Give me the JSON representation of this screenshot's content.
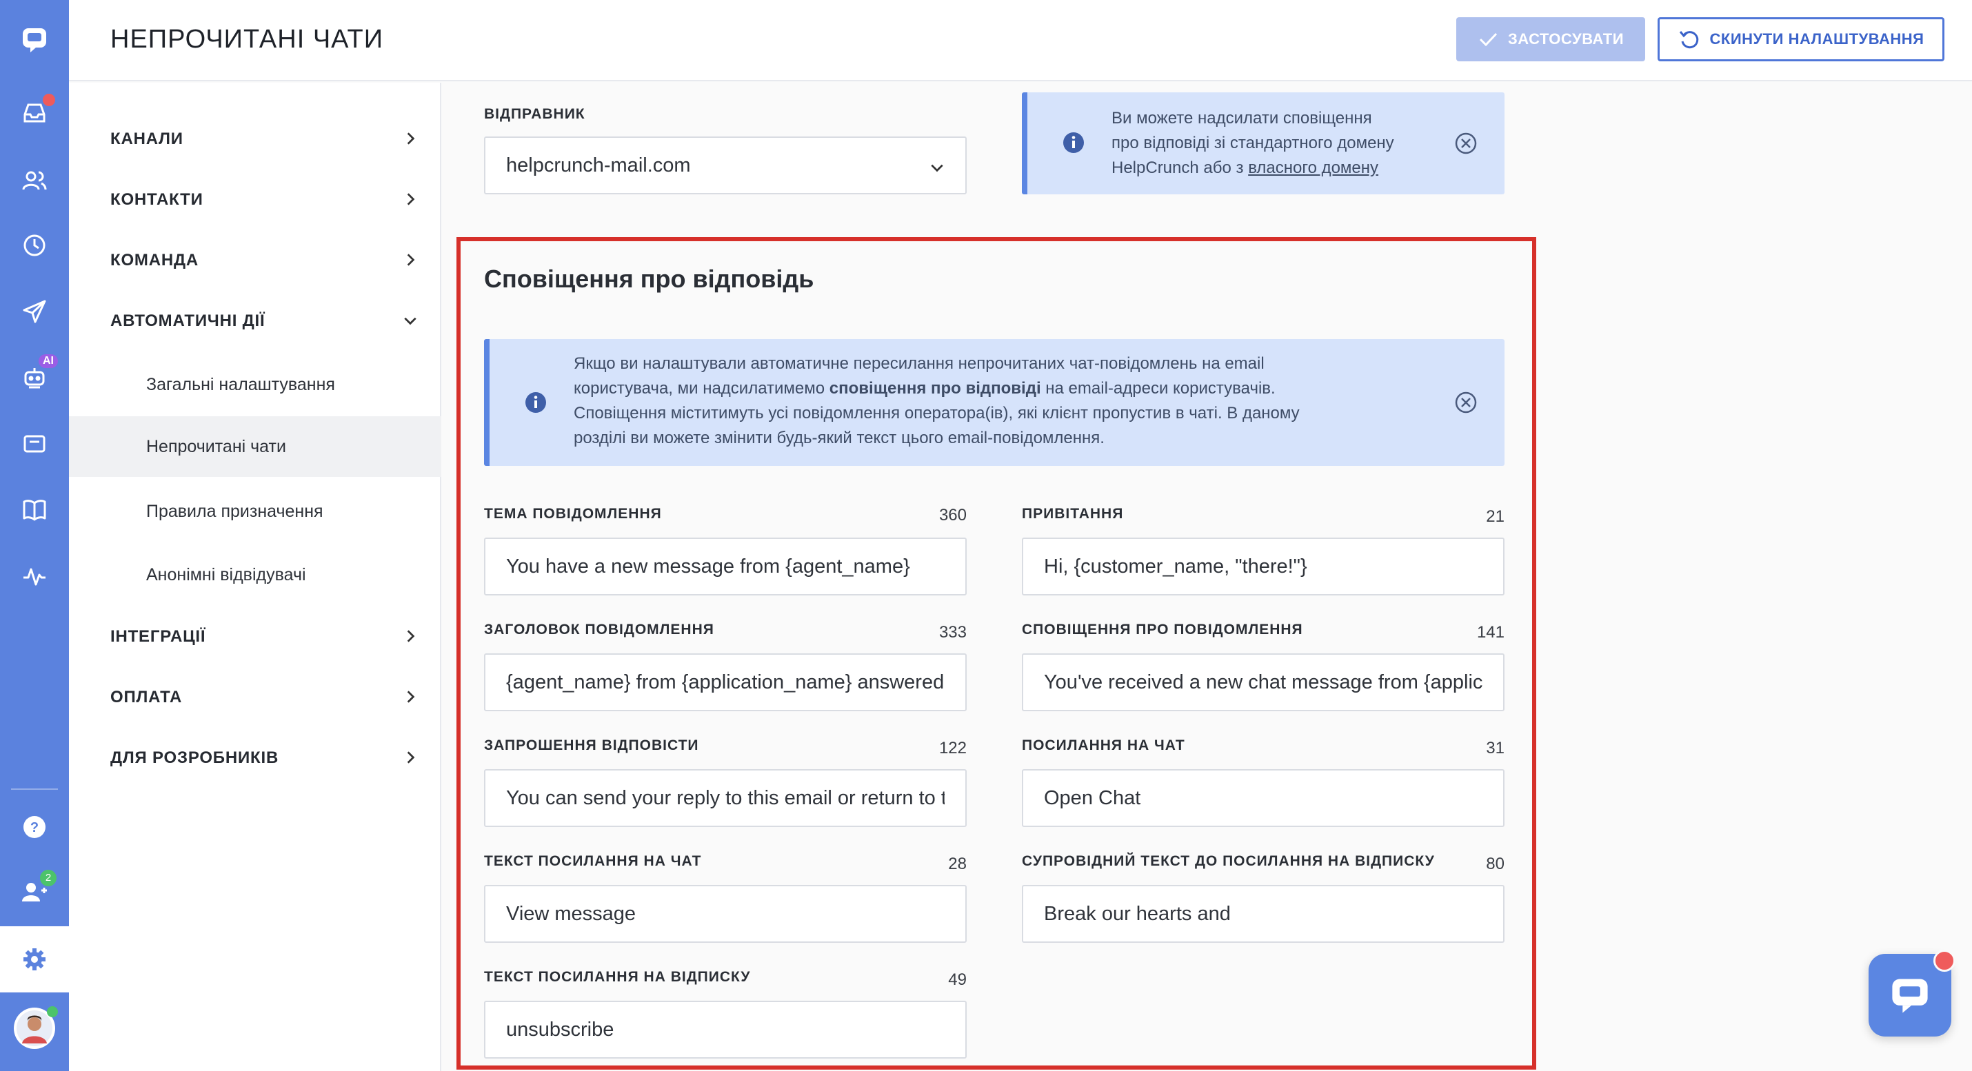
{
  "header": {
    "title": "НЕПРОЧИТАНІ ЧАТИ",
    "apply_label": "ЗАСТОСУВАТИ",
    "reset_label": "СКИНУТИ НАЛАШТУВАННЯ"
  },
  "rail": {
    "icons": [
      "logo-chat-icon",
      "inbox-icon",
      "contacts-icon",
      "clock-icon",
      "send-icon",
      "bot-icon",
      "card-icon",
      "book-icon",
      "activity-icon",
      "help-icon",
      "team-icon",
      "settings-icon",
      "avatar"
    ],
    "ai_badge": "AI",
    "team_count": "2"
  },
  "sidebar": {
    "items": [
      {
        "label": "КАНАЛИ"
      },
      {
        "label": "КОНТАКТИ"
      },
      {
        "label": "КОМАНДА"
      },
      {
        "label": "АВТОМАТИЧНІ ДІЇ"
      },
      {
        "label": "Загальні налаштування"
      },
      {
        "label": "Непрочитані чати"
      },
      {
        "label": "Правила призначення"
      },
      {
        "label": "Анонімні відвідувачі"
      },
      {
        "label": "ІНТЕГРАЦІЇ"
      },
      {
        "label": "ОПЛАТА"
      },
      {
        "label": "ДЛЯ РОЗРОБНИКІВ"
      }
    ]
  },
  "sender": {
    "label": "ВІДПРАВНИК",
    "value": "helpcrunch-mail.com"
  },
  "domain_info": {
    "line1": "Ви можете надсилати сповіщення",
    "line2": "про відповіді зі стандартного домену",
    "line3_prefix": "HelpCrunch або з ",
    "link": "власного домену"
  },
  "section": {
    "title": "Сповіщення про відповідь",
    "info_l1": "Якщо ви налаштували автоматичне пересилання непрочитаних чат-повідомлень на email",
    "info_l2_a": "користувача, ми надсилатимемо ",
    "info_l2_bold": "сповіщення про відповіді",
    "info_l2_b": " на email-адреси користувачів.",
    "info_l3": "Сповіщення міститимуть усі повідомлення оператора(ів), які клієнт пропустив в чаті. В даному",
    "info_l4": "розділі ви можете змінити будь-який текст цього email-повідомлення."
  },
  "fields": {
    "subject": {
      "label": "ТЕМА ПОВІДОМЛЕННЯ",
      "count": "360",
      "value": "You have a new message from {agent_name}"
    },
    "greeting": {
      "label": "ПРИВІТАННЯ",
      "count": "21",
      "value": "Hi, {customer_name, \"there!\"}"
    },
    "heading": {
      "label": "ЗАГОЛОВОК ПОВІДОМЛЕННЯ",
      "count": "333",
      "value": "{agent_name} from {application_name} answered"
    },
    "notification": {
      "label": "СПОВІЩЕННЯ ПРО ПОВІДОМЛЕННЯ",
      "count": "141",
      "value": "You've received a new chat message from {application_name}"
    },
    "reply_invite": {
      "label": "ЗАПРОШЕННЯ ВІДПОВІСТИ",
      "count": "122",
      "value": "You can send your reply to this email or return to the chat"
    },
    "chat_link": {
      "label": "ПОСИЛАННЯ НА ЧАТ",
      "count": "31",
      "value": "Open Chat"
    },
    "chat_link_text": {
      "label": "ТЕКСТ ПОСИЛАННЯ НА ЧАТ",
      "count": "28",
      "value": "View message"
    },
    "unsub_companion": {
      "label": "СУПРОВІДНИЙ ТЕКСТ ДО ПОСИЛАННЯ НА ВІДПИСКУ",
      "count": "80",
      "value": "Break our hearts and"
    },
    "unsub_link": {
      "label": "ТЕКСТ ПОСИЛАННЯ НА ВІДПИСКУ",
      "count": "49",
      "value": "unsubscribe"
    }
  },
  "colors": {
    "rail": "#5b82de",
    "accent": "#4f76d8",
    "info_bg": "#d6e3fb",
    "highlight": "#d6302a",
    "badge_red": "#ef5b5b",
    "badge_green": "#4cc36a",
    "badge_purple": "#9b5de5"
  }
}
